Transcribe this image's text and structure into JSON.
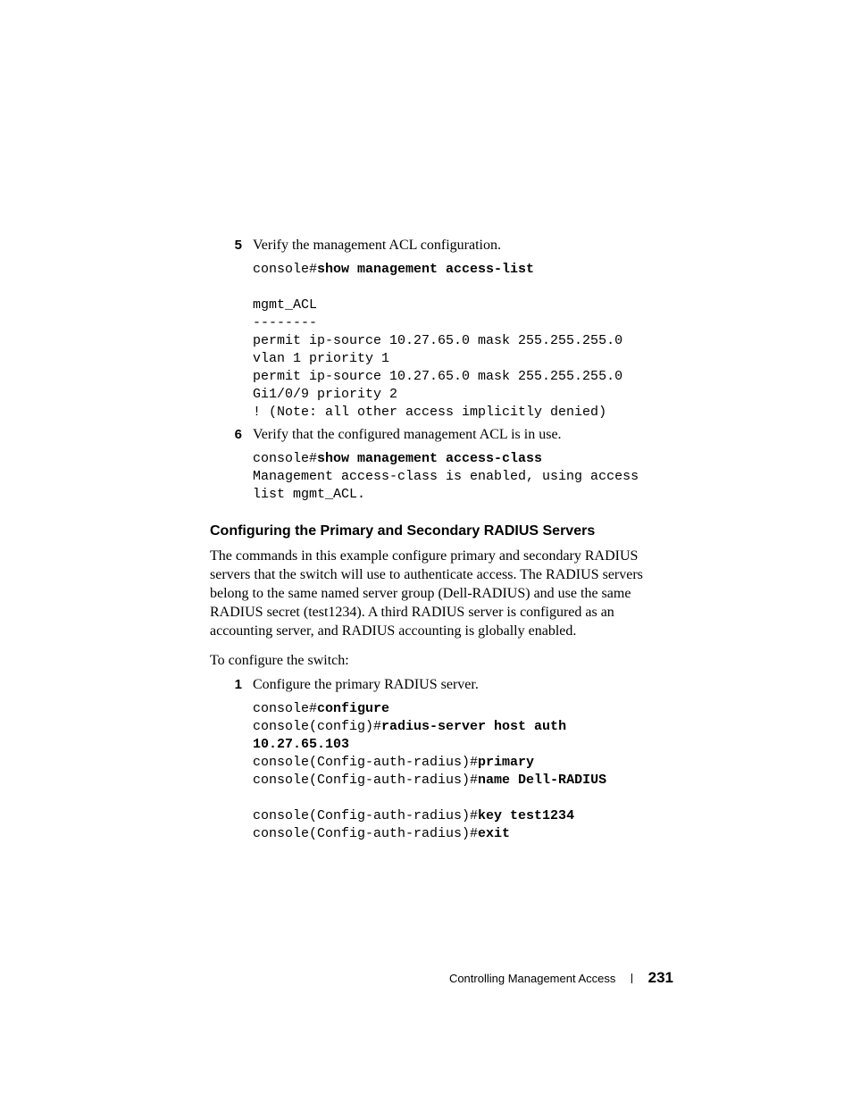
{
  "steps_a": [
    {
      "num": "5",
      "text": "Verify the management ACL configuration.",
      "code_parts": [
        {
          "t": "console#",
          "b": false
        },
        {
          "t": "show management access-list",
          "b": true
        },
        {
          "t": "\n\nmgmt_ACL\n--------\npermit ip-source 10.27.65.0 mask 255.255.255.0 \nvlan 1 priority 1\npermit ip-source 10.27.65.0 mask 255.255.255.0 \nGi1/0/9 priority 2\n! (Note: all other access implicitly denied)",
          "b": false
        }
      ]
    },
    {
      "num": "6",
      "text": "Verify that the configured management ACL is in use.",
      "code_parts": [
        {
          "t": "console#",
          "b": false
        },
        {
          "t": "show management access-class",
          "b": true
        },
        {
          "t": "\nManagement access-class is enabled, using access \nlist mgmt_ACL.",
          "b": false
        }
      ]
    }
  ],
  "heading": "Configuring the Primary and Secondary RADIUS Servers",
  "intro": "The commands in this example configure primary and secondary RADIUS servers that the switch will use to authenticate access. The RADIUS servers belong to the same named server group (Dell-RADIUS) and use the same RADIUS secret (test1234). A third RADIUS server is configured as an accounting server, and RADIUS accounting is globally enabled.",
  "lead": "To configure the switch:",
  "steps_b": [
    {
      "num": "1",
      "text": "Configure the primary RADIUS server.",
      "code_parts": [
        {
          "t": "console#",
          "b": false
        },
        {
          "t": "configure",
          "b": true
        },
        {
          "t": "\nconsole(config)#",
          "b": false
        },
        {
          "t": "radius-server host auth \n10.27.65.103",
          "b": true
        },
        {
          "t": "\nconsole(Config-auth-radius)#",
          "b": false
        },
        {
          "t": "primary",
          "b": true
        },
        {
          "t": "\nconsole(Config-auth-radius)#",
          "b": false
        },
        {
          "t": "name Dell-RADIUS",
          "b": true
        },
        {
          "t": "\n\nconsole(Config-auth-radius)#",
          "b": false
        },
        {
          "t": "key test1234",
          "b": true
        },
        {
          "t": "\nconsole(Config-auth-radius)#",
          "b": false
        },
        {
          "t": "exit",
          "b": true
        }
      ]
    }
  ],
  "footer": {
    "section": "Controlling Management Access",
    "page": "231"
  }
}
